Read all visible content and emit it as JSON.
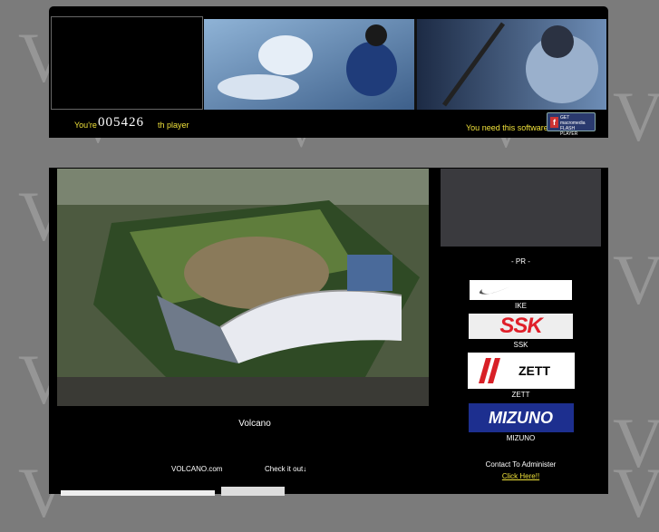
{
  "background": {
    "letters": [
      "V",
      "V",
      "V",
      "V",
      "V",
      "V",
      "V",
      "V",
      "V",
      "V",
      "V"
    ]
  },
  "header": {
    "counter_prefix": "You're",
    "counter_value": "005426",
    "counter_suffix": "th player",
    "need_software": "You need this software",
    "flash_badge": "GET macromedia FLASH PLAYER"
  },
  "main": {
    "photo_caption": "Volcano",
    "site_link": "VOLCANO.com",
    "check_link": "Check it out↓"
  },
  "sidebar": {
    "pr_label": "- PR -",
    "sponsors": [
      {
        "name": "IKE"
      },
      {
        "name": "SSK",
        "logo_text": "SSK"
      },
      {
        "name": "ZETT",
        "logo_text": "ZETT"
      },
      {
        "name": "MIZUNO",
        "logo_text": "MIZUNO"
      }
    ],
    "contact_label": "Contact To Administer",
    "contact_link": "Click Here!!"
  },
  "colors": {
    "accent_yellow": "#f0e23a",
    "page_bg": "#7b7b7b",
    "panel_bg": "#000000"
  }
}
